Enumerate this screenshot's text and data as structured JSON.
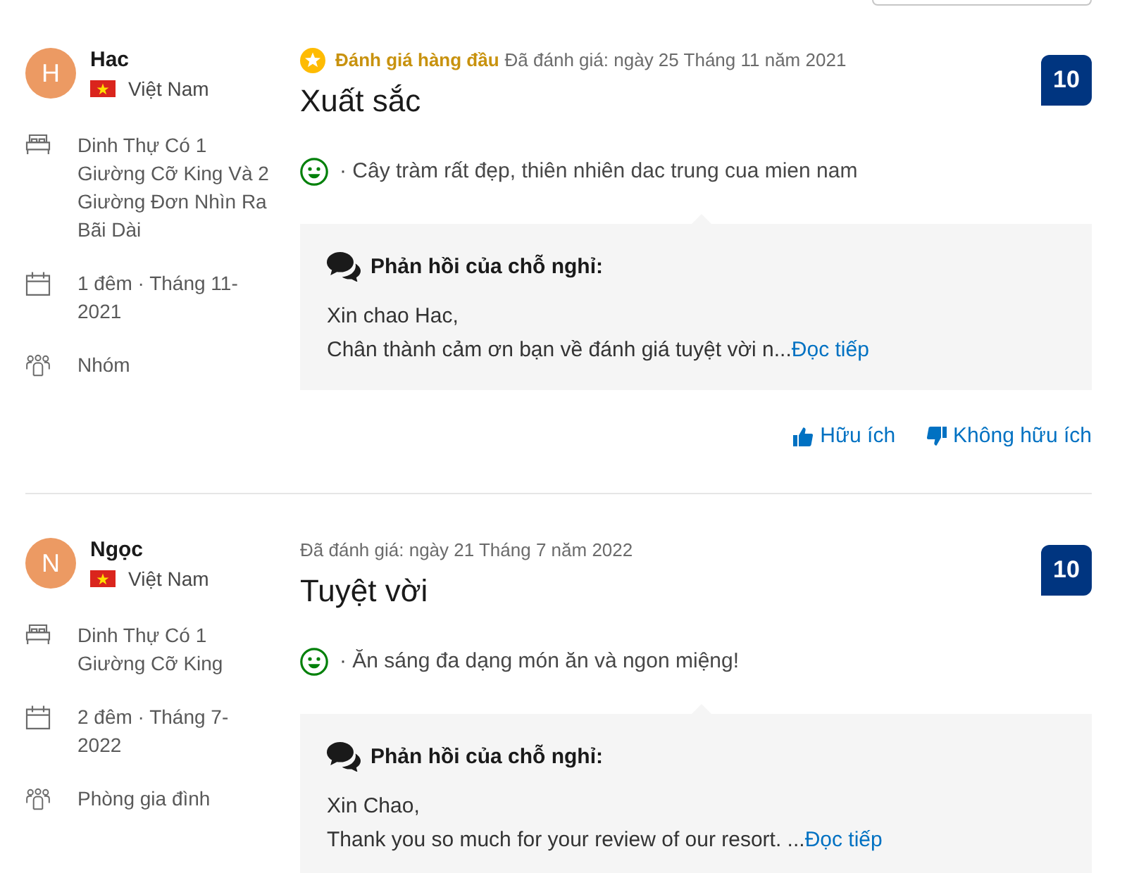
{
  "reviews": [
    {
      "reviewer": {
        "initial": "H",
        "name": "Hac",
        "country": "Việt Nam"
      },
      "stay": [
        {
          "kind": "room",
          "text": "Dinh Thự Có 1 Giường Cỡ King Và 2 Giường Đơn Nhìn Ra Bãi Dài"
        },
        {
          "kind": "dates",
          "text": "1 đêm · Tháng 11-2021"
        },
        {
          "kind": "traveler",
          "text": "Nhóm"
        }
      ],
      "badge": "Đánh giá hàng đầu",
      "date": "Đã đánh giá: ngày 25 Tháng 11 năm 2021",
      "title": "Xuất sắc",
      "score": "10",
      "comments": [
        {
          "kind": "liked",
          "text": "· Cây tràm rất đẹp, thiên nhiên dac trung cua mien nam"
        }
      ],
      "response": {
        "heading": "Phản hồi của chỗ nghỉ:",
        "lines": [
          "Xin chao Hac,",
          "Chân thành cảm ơn bạn về đánh giá tuyệt vời n..."
        ],
        "link": "Đọc tiếp"
      },
      "feedback": [
        {
          "kind": "helpful",
          "label": "Hữu ích"
        },
        {
          "kind": "unhelpful",
          "label": "Không hữu ích"
        }
      ]
    },
    {
      "reviewer": {
        "initial": "N",
        "name": "Ngọc",
        "country": "Việt Nam"
      },
      "stay": [
        {
          "kind": "room",
          "text": "Dinh Thự Có 1 Giường Cỡ King"
        },
        {
          "kind": "dates",
          "text": "2 đêm · Tháng 7-2022"
        },
        {
          "kind": "traveler",
          "text": "Phòng gia đình"
        }
      ],
      "date": "Đã đánh giá: ngày 21 Tháng 7 năm 2022",
      "title": "Tuyệt vời",
      "score": "10",
      "comments": [
        {
          "kind": "liked",
          "text": "· Ăn sáng đa dạng món ăn và ngon miệng!"
        }
      ],
      "response": {
        "heading": "Phản hồi của chỗ nghỉ:",
        "lines": [
          "Xin Chao,",
          "Thank you so much for your review of our resort. ..."
        ],
        "link": "Đọc tiếp"
      }
    }
  ]
}
